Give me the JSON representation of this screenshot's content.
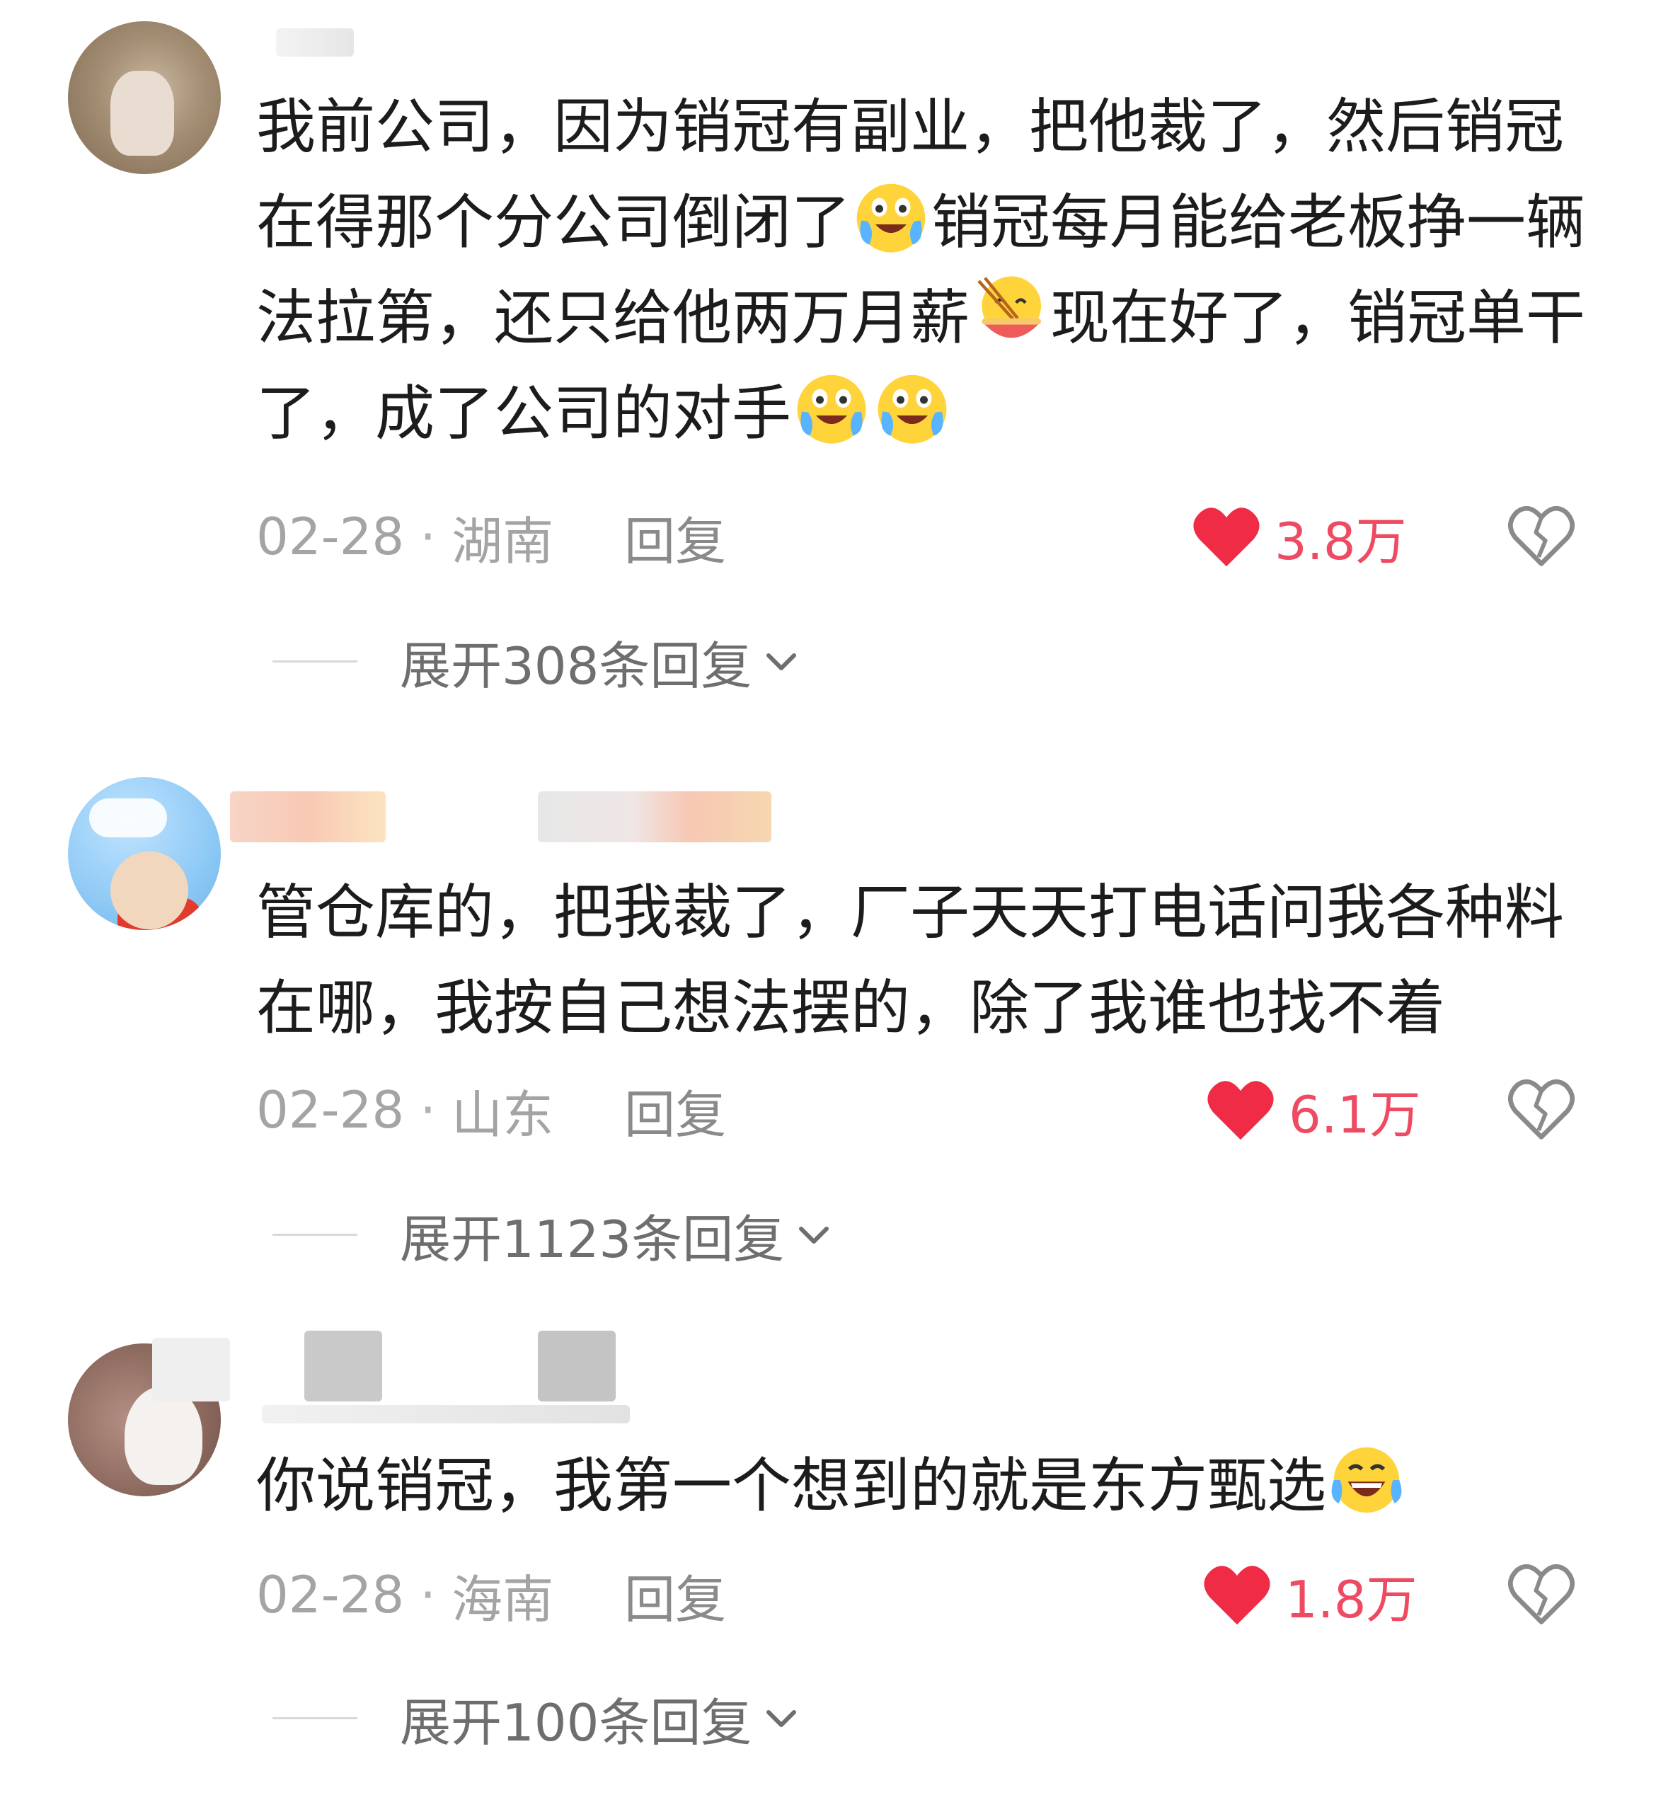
{
  "comments": [
    {
      "text_parts": [
        "我前公司，因为销冠有副业，把他裁了，然后销冠在得那个分公司倒闭了",
        "销冠每月能给老板挣一辆法拉第，还只给他两万月薪",
        "现在好了，销冠单干了，成了公司的对手"
      ],
      "emoji": [
        "crying-laugh-emoji",
        "eating-noodles-emoji",
        "crying-laugh-emoji",
        "crying-laugh-emoji"
      ],
      "date": "02-28",
      "location": "湖南",
      "reply_label": "回复",
      "likes": "3.8万",
      "expand_label": "展开308条回复"
    },
    {
      "text": "管仓库的，把我裁了，厂子天天打电话问我各种料在哪，我按自己想法摆的，除了我谁也找不着",
      "date": "02-28",
      "location": "山东",
      "reply_label": "回复",
      "likes": "6.1万",
      "expand_label": "展开1123条回复"
    },
    {
      "text": "你说销冠，我第一个想到的就是东方甄选",
      "emoji": [
        "laughing-tears-emoji"
      ],
      "date": "02-28",
      "location": "海南",
      "reply_label": "回复",
      "likes": "1.8万",
      "expand_label": "展开100条回复"
    }
  ],
  "separator": "·",
  "colors": {
    "like_red": "#ee4a61",
    "heart_red": "#ef2b46",
    "text_dark": "#1c1c1c",
    "meta_gray": "#a4a4a4"
  },
  "icons": {
    "like": "heart-icon",
    "dislike": "broken-heart-icon",
    "expand": "chevron-down-icon"
  }
}
